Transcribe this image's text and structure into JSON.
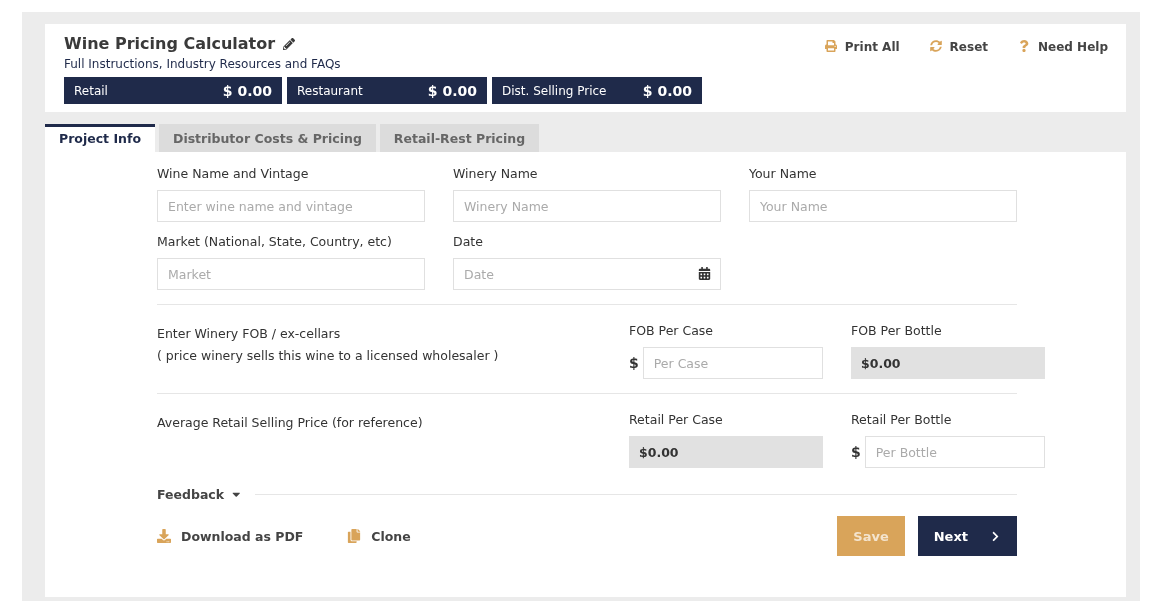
{
  "header": {
    "title": "Wine Pricing Calculator",
    "subtitle": "Full Instructions, Industry Resources and FAQs",
    "actions": [
      {
        "kind": "print",
        "label": "Print All"
      },
      {
        "kind": "reset",
        "label": "Reset"
      },
      {
        "kind": "help",
        "label": "Need Help"
      }
    ],
    "totals": [
      {
        "label": "Retail",
        "value": "$ 0.00"
      },
      {
        "label": "Restaurant",
        "value": "$ 0.00"
      },
      {
        "label": "Dist. Selling Price",
        "value": "$ 0.00"
      }
    ]
  },
  "tabs": [
    {
      "label": "Project Info",
      "selected": true
    },
    {
      "label": "Distributor Costs & Pricing",
      "selected": false
    },
    {
      "label": "Retail-Rest Pricing",
      "selected": false
    }
  ],
  "fields": [
    {
      "label": "Wine Name and Vintage",
      "placeholder": "Enter wine name and vintage",
      "kind": "text"
    },
    {
      "label": "Winery Name",
      "placeholder": "Winery Name",
      "kind": "text"
    },
    {
      "label": "Your Name",
      "placeholder": "Your Name",
      "kind": "text"
    },
    {
      "label": "Market (National, State, Country, etc)",
      "placeholder": "Market",
      "kind": "text"
    },
    {
      "label": "Date",
      "placeholder": "Date",
      "kind": "date"
    }
  ],
  "pricing": [
    {
      "title": "Enter Winery FOB / ex-cellars",
      "note": "( price winery sells this wine to a licensed wholesaler )",
      "cells": [
        {
          "label": "FOB Per Case",
          "kind": "input",
          "currency": "$",
          "placeholder": "Per Case"
        },
        {
          "label": "FOB Per Bottle",
          "kind": "readonly",
          "value": "$0.00"
        }
      ]
    },
    {
      "title": "Average Retail Selling Price (for reference)",
      "cells": [
        {
          "label": "Retail Per Case",
          "kind": "readonly",
          "value": "$0.00"
        },
        {
          "label": "Retail Per Bottle",
          "kind": "input",
          "currency": "$",
          "placeholder": "Per Bottle"
        }
      ]
    }
  ],
  "feedback": {
    "label": "Feedback",
    "expanded": false
  },
  "footer_links": [
    {
      "kind": "download",
      "label": "Download as PDF"
    },
    {
      "kind": "clone",
      "label": "Clone"
    }
  ],
  "buttons": [
    {
      "kind": "save",
      "label": "Save",
      "disabled": true
    },
    {
      "kind": "next",
      "label": "Next",
      "disabled": false
    }
  ]
}
